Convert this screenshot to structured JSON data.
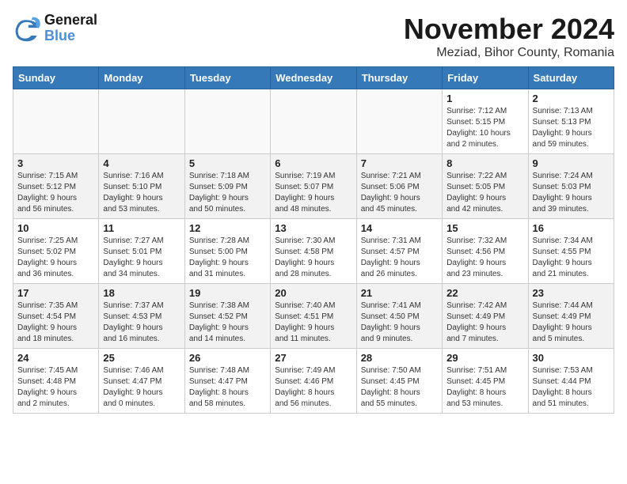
{
  "header": {
    "logo_general": "General",
    "logo_blue": "Blue",
    "title": "November 2024",
    "location": "Meziad, Bihor County, Romania"
  },
  "days_of_week": [
    "Sunday",
    "Monday",
    "Tuesday",
    "Wednesday",
    "Thursday",
    "Friday",
    "Saturday"
  ],
  "weeks": [
    [
      {
        "day": "",
        "info": ""
      },
      {
        "day": "",
        "info": ""
      },
      {
        "day": "",
        "info": ""
      },
      {
        "day": "",
        "info": ""
      },
      {
        "day": "",
        "info": ""
      },
      {
        "day": "1",
        "info": "Sunrise: 7:12 AM\nSunset: 5:15 PM\nDaylight: 10 hours\nand 2 minutes."
      },
      {
        "day": "2",
        "info": "Sunrise: 7:13 AM\nSunset: 5:13 PM\nDaylight: 9 hours\nand 59 minutes."
      }
    ],
    [
      {
        "day": "3",
        "info": "Sunrise: 7:15 AM\nSunset: 5:12 PM\nDaylight: 9 hours\nand 56 minutes."
      },
      {
        "day": "4",
        "info": "Sunrise: 7:16 AM\nSunset: 5:10 PM\nDaylight: 9 hours\nand 53 minutes."
      },
      {
        "day": "5",
        "info": "Sunrise: 7:18 AM\nSunset: 5:09 PM\nDaylight: 9 hours\nand 50 minutes."
      },
      {
        "day": "6",
        "info": "Sunrise: 7:19 AM\nSunset: 5:07 PM\nDaylight: 9 hours\nand 48 minutes."
      },
      {
        "day": "7",
        "info": "Sunrise: 7:21 AM\nSunset: 5:06 PM\nDaylight: 9 hours\nand 45 minutes."
      },
      {
        "day": "8",
        "info": "Sunrise: 7:22 AM\nSunset: 5:05 PM\nDaylight: 9 hours\nand 42 minutes."
      },
      {
        "day": "9",
        "info": "Sunrise: 7:24 AM\nSunset: 5:03 PM\nDaylight: 9 hours\nand 39 minutes."
      }
    ],
    [
      {
        "day": "10",
        "info": "Sunrise: 7:25 AM\nSunset: 5:02 PM\nDaylight: 9 hours\nand 36 minutes."
      },
      {
        "day": "11",
        "info": "Sunrise: 7:27 AM\nSunset: 5:01 PM\nDaylight: 9 hours\nand 34 minutes."
      },
      {
        "day": "12",
        "info": "Sunrise: 7:28 AM\nSunset: 5:00 PM\nDaylight: 9 hours\nand 31 minutes."
      },
      {
        "day": "13",
        "info": "Sunrise: 7:30 AM\nSunset: 4:58 PM\nDaylight: 9 hours\nand 28 minutes."
      },
      {
        "day": "14",
        "info": "Sunrise: 7:31 AM\nSunset: 4:57 PM\nDaylight: 9 hours\nand 26 minutes."
      },
      {
        "day": "15",
        "info": "Sunrise: 7:32 AM\nSunset: 4:56 PM\nDaylight: 9 hours\nand 23 minutes."
      },
      {
        "day": "16",
        "info": "Sunrise: 7:34 AM\nSunset: 4:55 PM\nDaylight: 9 hours\nand 21 minutes."
      }
    ],
    [
      {
        "day": "17",
        "info": "Sunrise: 7:35 AM\nSunset: 4:54 PM\nDaylight: 9 hours\nand 18 minutes."
      },
      {
        "day": "18",
        "info": "Sunrise: 7:37 AM\nSunset: 4:53 PM\nDaylight: 9 hours\nand 16 minutes."
      },
      {
        "day": "19",
        "info": "Sunrise: 7:38 AM\nSunset: 4:52 PM\nDaylight: 9 hours\nand 14 minutes."
      },
      {
        "day": "20",
        "info": "Sunrise: 7:40 AM\nSunset: 4:51 PM\nDaylight: 9 hours\nand 11 minutes."
      },
      {
        "day": "21",
        "info": "Sunrise: 7:41 AM\nSunset: 4:50 PM\nDaylight: 9 hours\nand 9 minutes."
      },
      {
        "day": "22",
        "info": "Sunrise: 7:42 AM\nSunset: 4:49 PM\nDaylight: 9 hours\nand 7 minutes."
      },
      {
        "day": "23",
        "info": "Sunrise: 7:44 AM\nSunset: 4:49 PM\nDaylight: 9 hours\nand 5 minutes."
      }
    ],
    [
      {
        "day": "24",
        "info": "Sunrise: 7:45 AM\nSunset: 4:48 PM\nDaylight: 9 hours\nand 2 minutes."
      },
      {
        "day": "25",
        "info": "Sunrise: 7:46 AM\nSunset: 4:47 PM\nDaylight: 9 hours\nand 0 minutes."
      },
      {
        "day": "26",
        "info": "Sunrise: 7:48 AM\nSunset: 4:47 PM\nDaylight: 8 hours\nand 58 minutes."
      },
      {
        "day": "27",
        "info": "Sunrise: 7:49 AM\nSunset: 4:46 PM\nDaylight: 8 hours\nand 56 minutes."
      },
      {
        "day": "28",
        "info": "Sunrise: 7:50 AM\nSunset: 4:45 PM\nDaylight: 8 hours\nand 55 minutes."
      },
      {
        "day": "29",
        "info": "Sunrise: 7:51 AM\nSunset: 4:45 PM\nDaylight: 8 hours\nand 53 minutes."
      },
      {
        "day": "30",
        "info": "Sunrise: 7:53 AM\nSunset: 4:44 PM\nDaylight: 8 hours\nand 51 minutes."
      }
    ]
  ]
}
